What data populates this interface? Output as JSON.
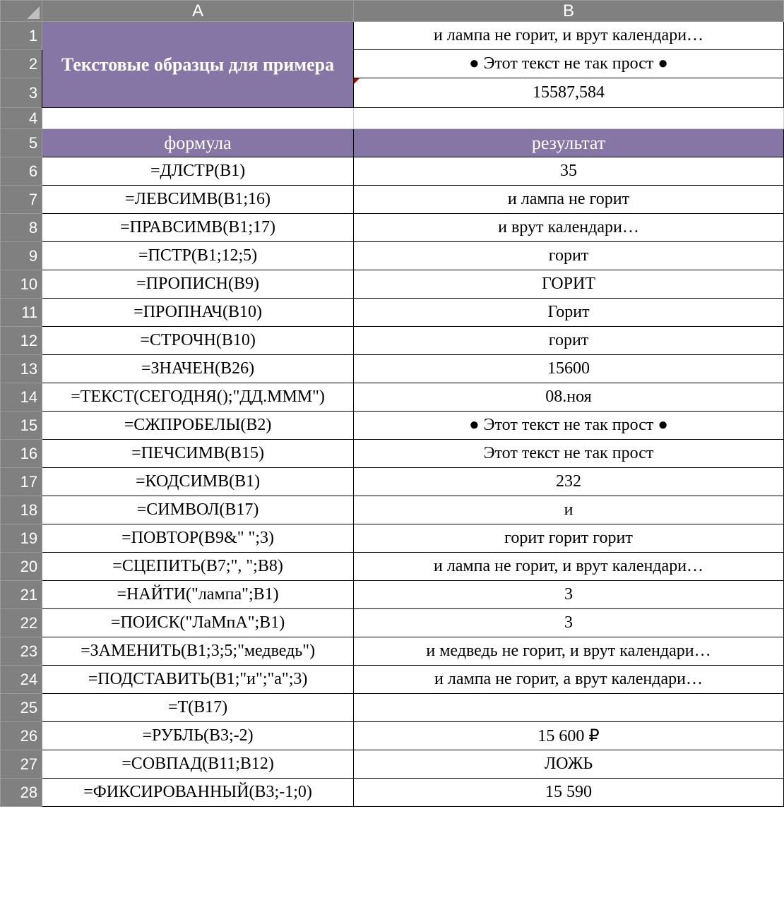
{
  "columns": {
    "a": "A",
    "b": "B"
  },
  "merged_title": "Текстовые образцы для примера",
  "top_b": {
    "b1": "и лампа не горит, и врут календари…",
    "b2": "●    Этот текст не так прост   ●",
    "b3": "15587,584"
  },
  "section": {
    "formula": "формула",
    "result": "результат"
  },
  "rows": [
    {
      "n": "1"
    },
    {
      "n": "2"
    },
    {
      "n": "3"
    },
    {
      "n": "4"
    },
    {
      "n": "5"
    },
    {
      "n": "6",
      "a": "=ДЛСТР(B1)",
      "b": "35"
    },
    {
      "n": "7",
      "a": "=ЛЕВСИМВ(B1;16)",
      "b": "и лампа не горит"
    },
    {
      "n": "8",
      "a": "=ПРАВСИМВ(B1;17)",
      "b": "и врут календари…"
    },
    {
      "n": "9",
      "a": "=ПСТР(B1;12;5)",
      "b": "горит"
    },
    {
      "n": "10",
      "a": "=ПРОПИСН(B9)",
      "b": "ГОРИТ"
    },
    {
      "n": "11",
      "a": "=ПРОПНАЧ(B10)",
      "b": "Горит"
    },
    {
      "n": "12",
      "a": "=СТРОЧН(B10)",
      "b": "горит"
    },
    {
      "n": "13",
      "a": "=ЗНАЧЕН(B26)",
      "b": "15600"
    },
    {
      "n": "14",
      "a": "=ТЕКСТ(СЕГОДНЯ();\"ДД.МММ\")",
      "b": "08.ноя"
    },
    {
      "n": "15",
      "a": "=СЖПРОБЕЛЫ(B2)",
      "b": "● Этот текст не так прост ●"
    },
    {
      "n": "16",
      "a": "=ПЕЧСИМВ(B15)",
      "b": "Этот текст не так прост"
    },
    {
      "n": "17",
      "a": "=КОДСИМВ(B1)",
      "b": "232"
    },
    {
      "n": "18",
      "a": "=СИМВОЛ(B17)",
      "b": "и"
    },
    {
      "n": "19",
      "a": "=ПОВТОР(B9&\" \";3)",
      "b": "горит горит горит"
    },
    {
      "n": "20",
      "a": "=СЦЕПИТЬ(B7;\", \";B8)",
      "b": "и лампа не горит, и врут календари…"
    },
    {
      "n": "21",
      "a": "=НАЙТИ(\"лампа\";B1)",
      "b": "3"
    },
    {
      "n": "22",
      "a": "=ПОИСК(\"ЛаМпА\";B1)",
      "b": "3"
    },
    {
      "n": "23",
      "a": "=ЗАМЕНИТЬ(B1;3;5;\"медведь\")",
      "b": "и медведь не горит, и врут календари…"
    },
    {
      "n": "24",
      "a": "=ПОДСТАВИТЬ(B1;\"и\";\"а\";3)",
      "b": "и лампа не горит, а врут календари…"
    },
    {
      "n": "25",
      "a": "=Т(B17)",
      "b": ""
    },
    {
      "n": "26",
      "a": "=РУБЛЬ(B3;-2)",
      "b": "15 600 ₽"
    },
    {
      "n": "27",
      "a": "=СОВПАД(B11;B12)",
      "b": "ЛОЖЬ"
    },
    {
      "n": "28",
      "a": "=ФИКСИРОВАННЫЙ(B3;-1;0)",
      "b": "15 590"
    }
  ]
}
